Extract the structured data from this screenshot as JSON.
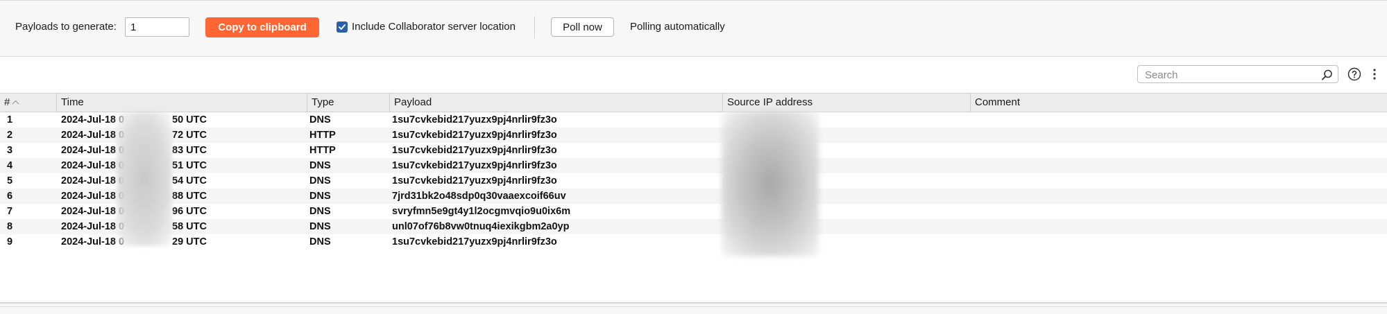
{
  "toolbar": {
    "payloads_label": "Payloads to generate:",
    "payloads_value": "1",
    "copy_button": "Copy to clipboard",
    "include_location_label": "Include Collaborator server location",
    "include_location_checked": true,
    "poll_button": "Poll now",
    "poll_status": "Polling automatically",
    "accent_color": "#ff6633"
  },
  "search": {
    "placeholder": "Search",
    "icons": [
      "search-icon",
      "help-icon",
      "more-vertical-icon"
    ]
  },
  "table": {
    "columns": [
      "#",
      "Time",
      "Type",
      "Payload",
      "Source IP address",
      "Comment"
    ],
    "sort_icon": "sort-ascending-icon",
    "rows": [
      {
        "num": "1",
        "time_left": "2024-Jul-18 0",
        "time_right": "50 UTC",
        "type": "DNS",
        "payload": "1su7cvkebid217yuzx9pj4nrlir9fz3o",
        "ip": "",
        "comment": ""
      },
      {
        "num": "2",
        "time_left": "2024-Jul-18 0",
        "time_right": "72 UTC",
        "type": "HTTP",
        "payload": "1su7cvkebid217yuzx9pj4nrlir9fz3o",
        "ip": "",
        "comment": ""
      },
      {
        "num": "3",
        "time_left": "2024-Jul-18 0",
        "time_right": "83 UTC",
        "type": "HTTP",
        "payload": "1su7cvkebid217yuzx9pj4nrlir9fz3o",
        "ip": "",
        "comment": ""
      },
      {
        "num": "4",
        "time_left": "2024-Jul-18 0",
        "time_right": "51 UTC",
        "type": "DNS",
        "payload": "1su7cvkebid217yuzx9pj4nrlir9fz3o",
        "ip": "",
        "comment": ""
      },
      {
        "num": "5",
        "time_left": "2024-Jul-18 0",
        "time_right": "54 UTC",
        "type": "DNS",
        "payload": "1su7cvkebid217yuzx9pj4nrlir9fz3o",
        "ip": "",
        "comment": ""
      },
      {
        "num": "6",
        "time_left": "2024-Jul-18 0",
        "time_right": "88 UTC",
        "type": "DNS",
        "payload": "7jrd31bk2o48sdp0q30vaaexcoif66uv",
        "ip": "",
        "comment": ""
      },
      {
        "num": "7",
        "time_left": "2024-Jul-18 0",
        "time_right": "96 UTC",
        "type": "DNS",
        "payload": "svryfmn5e9gt4y1l2ocgmvqio9u0ix6m",
        "ip": "",
        "comment": ""
      },
      {
        "num": "8",
        "time_left": "2024-Jul-18 0",
        "time_right": "58 UTC",
        "type": "DNS",
        "payload": "unl07of76b8vw0tnuq4iexikgbm2a0yp",
        "ip": "",
        "comment": ""
      },
      {
        "num": "9",
        "time_left": "2024-Jul-18 0",
        "time_right": "29 UTC",
        "type": "DNS",
        "payload": "1su7cvkebid217yuzx9pj4nrlir9fz3o",
        "ip": "",
        "comment": ""
      }
    ]
  }
}
